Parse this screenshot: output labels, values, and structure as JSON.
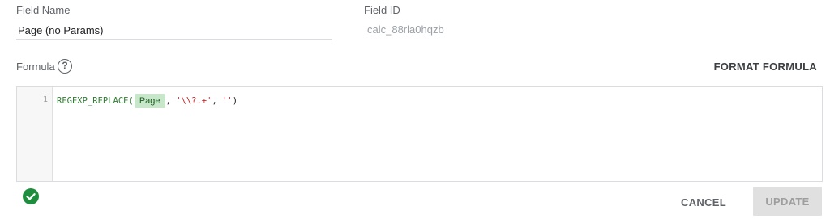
{
  "field_name": {
    "label": "Field Name",
    "value": "Page (no Params)"
  },
  "field_id": {
    "label": "Field ID",
    "value": "calc_88rla0hqzb"
  },
  "formula": {
    "label": "Formula",
    "help_icon": "?",
    "format_label": "FORMAT FORMULA",
    "line_number": "1",
    "tokens": {
      "fn": "REGEXP_REPLACE(",
      "field": "Page",
      "sep1": ", ",
      "pattern": "'\\\\?.+'",
      "sep2": ", ",
      "replacement": "''",
      "close": ")"
    },
    "colors": {
      "function": "#2e7d32",
      "string": "#c62828",
      "field_chip_bg": "#c8e6c9"
    }
  },
  "status": {
    "icon": "check-circle-icon",
    "state": "valid",
    "color": "#1e8e3e"
  },
  "actions": {
    "cancel_label": "CANCEL",
    "update_label": "UPDATE",
    "update_disabled": true
  }
}
